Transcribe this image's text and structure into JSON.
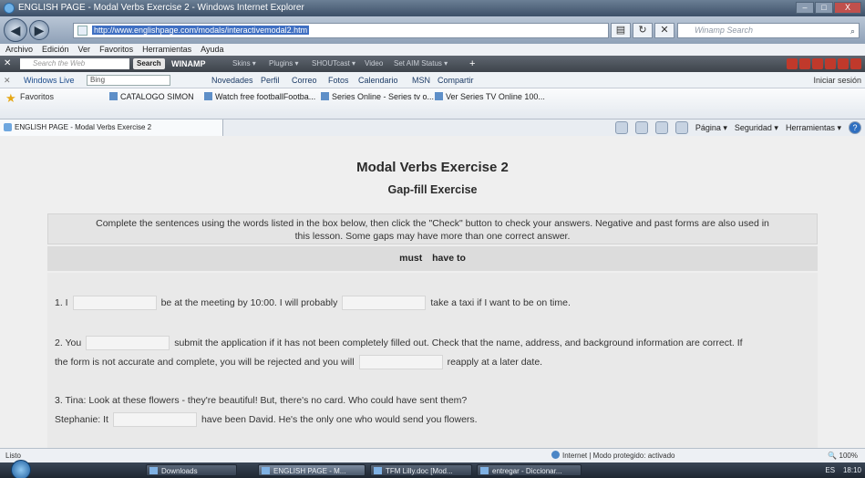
{
  "window": {
    "title": "ENGLISH PAGE - Modal Verbs Exercise 2 - Windows Internet Explorer",
    "buttons": [
      "–",
      "□",
      "X"
    ]
  },
  "address_bar": {
    "url": "http://www.englishpage.com/modals/interactivemodal2.htm",
    "search_placeholder": "Winamp Search"
  },
  "menu": [
    "Archivo",
    "Edición",
    "Ver",
    "Favoritos",
    "Herramientas",
    "Ayuda"
  ],
  "winamp_bar": {
    "search_placeholder": "Search the Web",
    "search_button": "Search",
    "logo": "WINAMP",
    "items": [
      "Skins ▾",
      "Plugins ▾",
      "SHOUTcast ▾",
      "Video",
      "Set AIM Status ▾",
      "+"
    ]
  },
  "windows_live_bar": {
    "label": "Windows Live",
    "search_value": "Bing",
    "links": [
      "Novedades",
      "Perfil",
      "Correo",
      "Fotos",
      "Calendario",
      "MSN",
      "Compartir"
    ],
    "signin": "Iniciar sesión"
  },
  "favorites_bar": {
    "label": "Favoritos",
    "links": [
      "CATALOGO SIMON",
      "Watch free footballFootba...",
      "Series Online - Series tv o...",
      "Ver Series TV Online 100..."
    ]
  },
  "tab": {
    "label": "ENGLISH PAGE - Modal Verbs Exercise 2"
  },
  "command_bar": {
    "items": [
      "Página ▾",
      "Seguridad ▾",
      "Herramientas ▾"
    ]
  },
  "page": {
    "title": "Modal Verbs Exercise 2",
    "subtitle": "Gap-fill Exercise",
    "instructions_1": "Complete the sentences using the words listed in the box below, then click the \"Check\" button to check your answers. Negative and past forms are also used in",
    "instructions_2": "this lesson. Some gaps may have more than one correct answer.",
    "words": [
      "must",
      "have to"
    ],
    "q1": {
      "prefix": "1. I",
      "middle": "be at the meeting by 10:00. I will probably",
      "suffix": "take a taxi if I want to be on time."
    },
    "q2": {
      "prefix": "2. You",
      "middle": "submit the application if it has not been completely filled out. Check that the name, address, and background information are correct. If",
      "line2_prefix": "the form is not accurate and complete, you will be rejected and you will",
      "line2_suffix": "reapply at a later date."
    },
    "q3": {
      "line1": "3. Tina: Look at these flowers - they're beautiful! But, there's no card. Who could have sent them?",
      "prefix": "Stephanie: It",
      "suffix": "have been David. He's the only one who would send you flowers."
    }
  },
  "status_bar": {
    "status": "Listo",
    "zone": "Internet | Modo protegido: activado",
    "zoom": "100%"
  },
  "taskbar": {
    "buttons": [
      "Downloads",
      "ENGLISH PAGE - M...",
      "TFM Lilly.doc [Mod...",
      "entregar - Diccionar..."
    ],
    "tray_lang": "ES",
    "clock": "18:10"
  }
}
